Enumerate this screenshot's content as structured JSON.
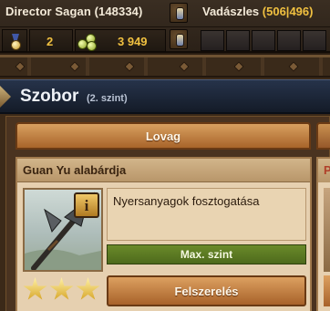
{
  "player": {
    "name": "Director Sagan",
    "id_text": "(148334)"
  },
  "hunt": {
    "label": "Vadászles",
    "value": "(506|496)"
  },
  "stats": {
    "medals": "2",
    "coins": "3 949"
  },
  "window": {
    "title": "Szobor",
    "subtitle": "(2. szint)"
  },
  "tabs": [
    {
      "label": "Lovag"
    }
  ],
  "item": {
    "name": "Guan Yu alabárdja",
    "info_glyph": "i",
    "description": "Nyersanyagok fosztogatása",
    "level_status": "Max. szint",
    "stars": 3,
    "equip_label": "Felszerelés"
  },
  "next_card": {
    "head_letter": "P"
  },
  "icons": {
    "medal": "medal-icon",
    "coins": "coins-icon",
    "info": "info-icon",
    "star": "star-icon",
    "weapon": "halberd-icon",
    "rank_badge": "rank-badge-icon"
  },
  "colors": {
    "gold_text": "#f0c040",
    "accent_green": "#5a7a22",
    "button_orange": "#c07a3a"
  }
}
